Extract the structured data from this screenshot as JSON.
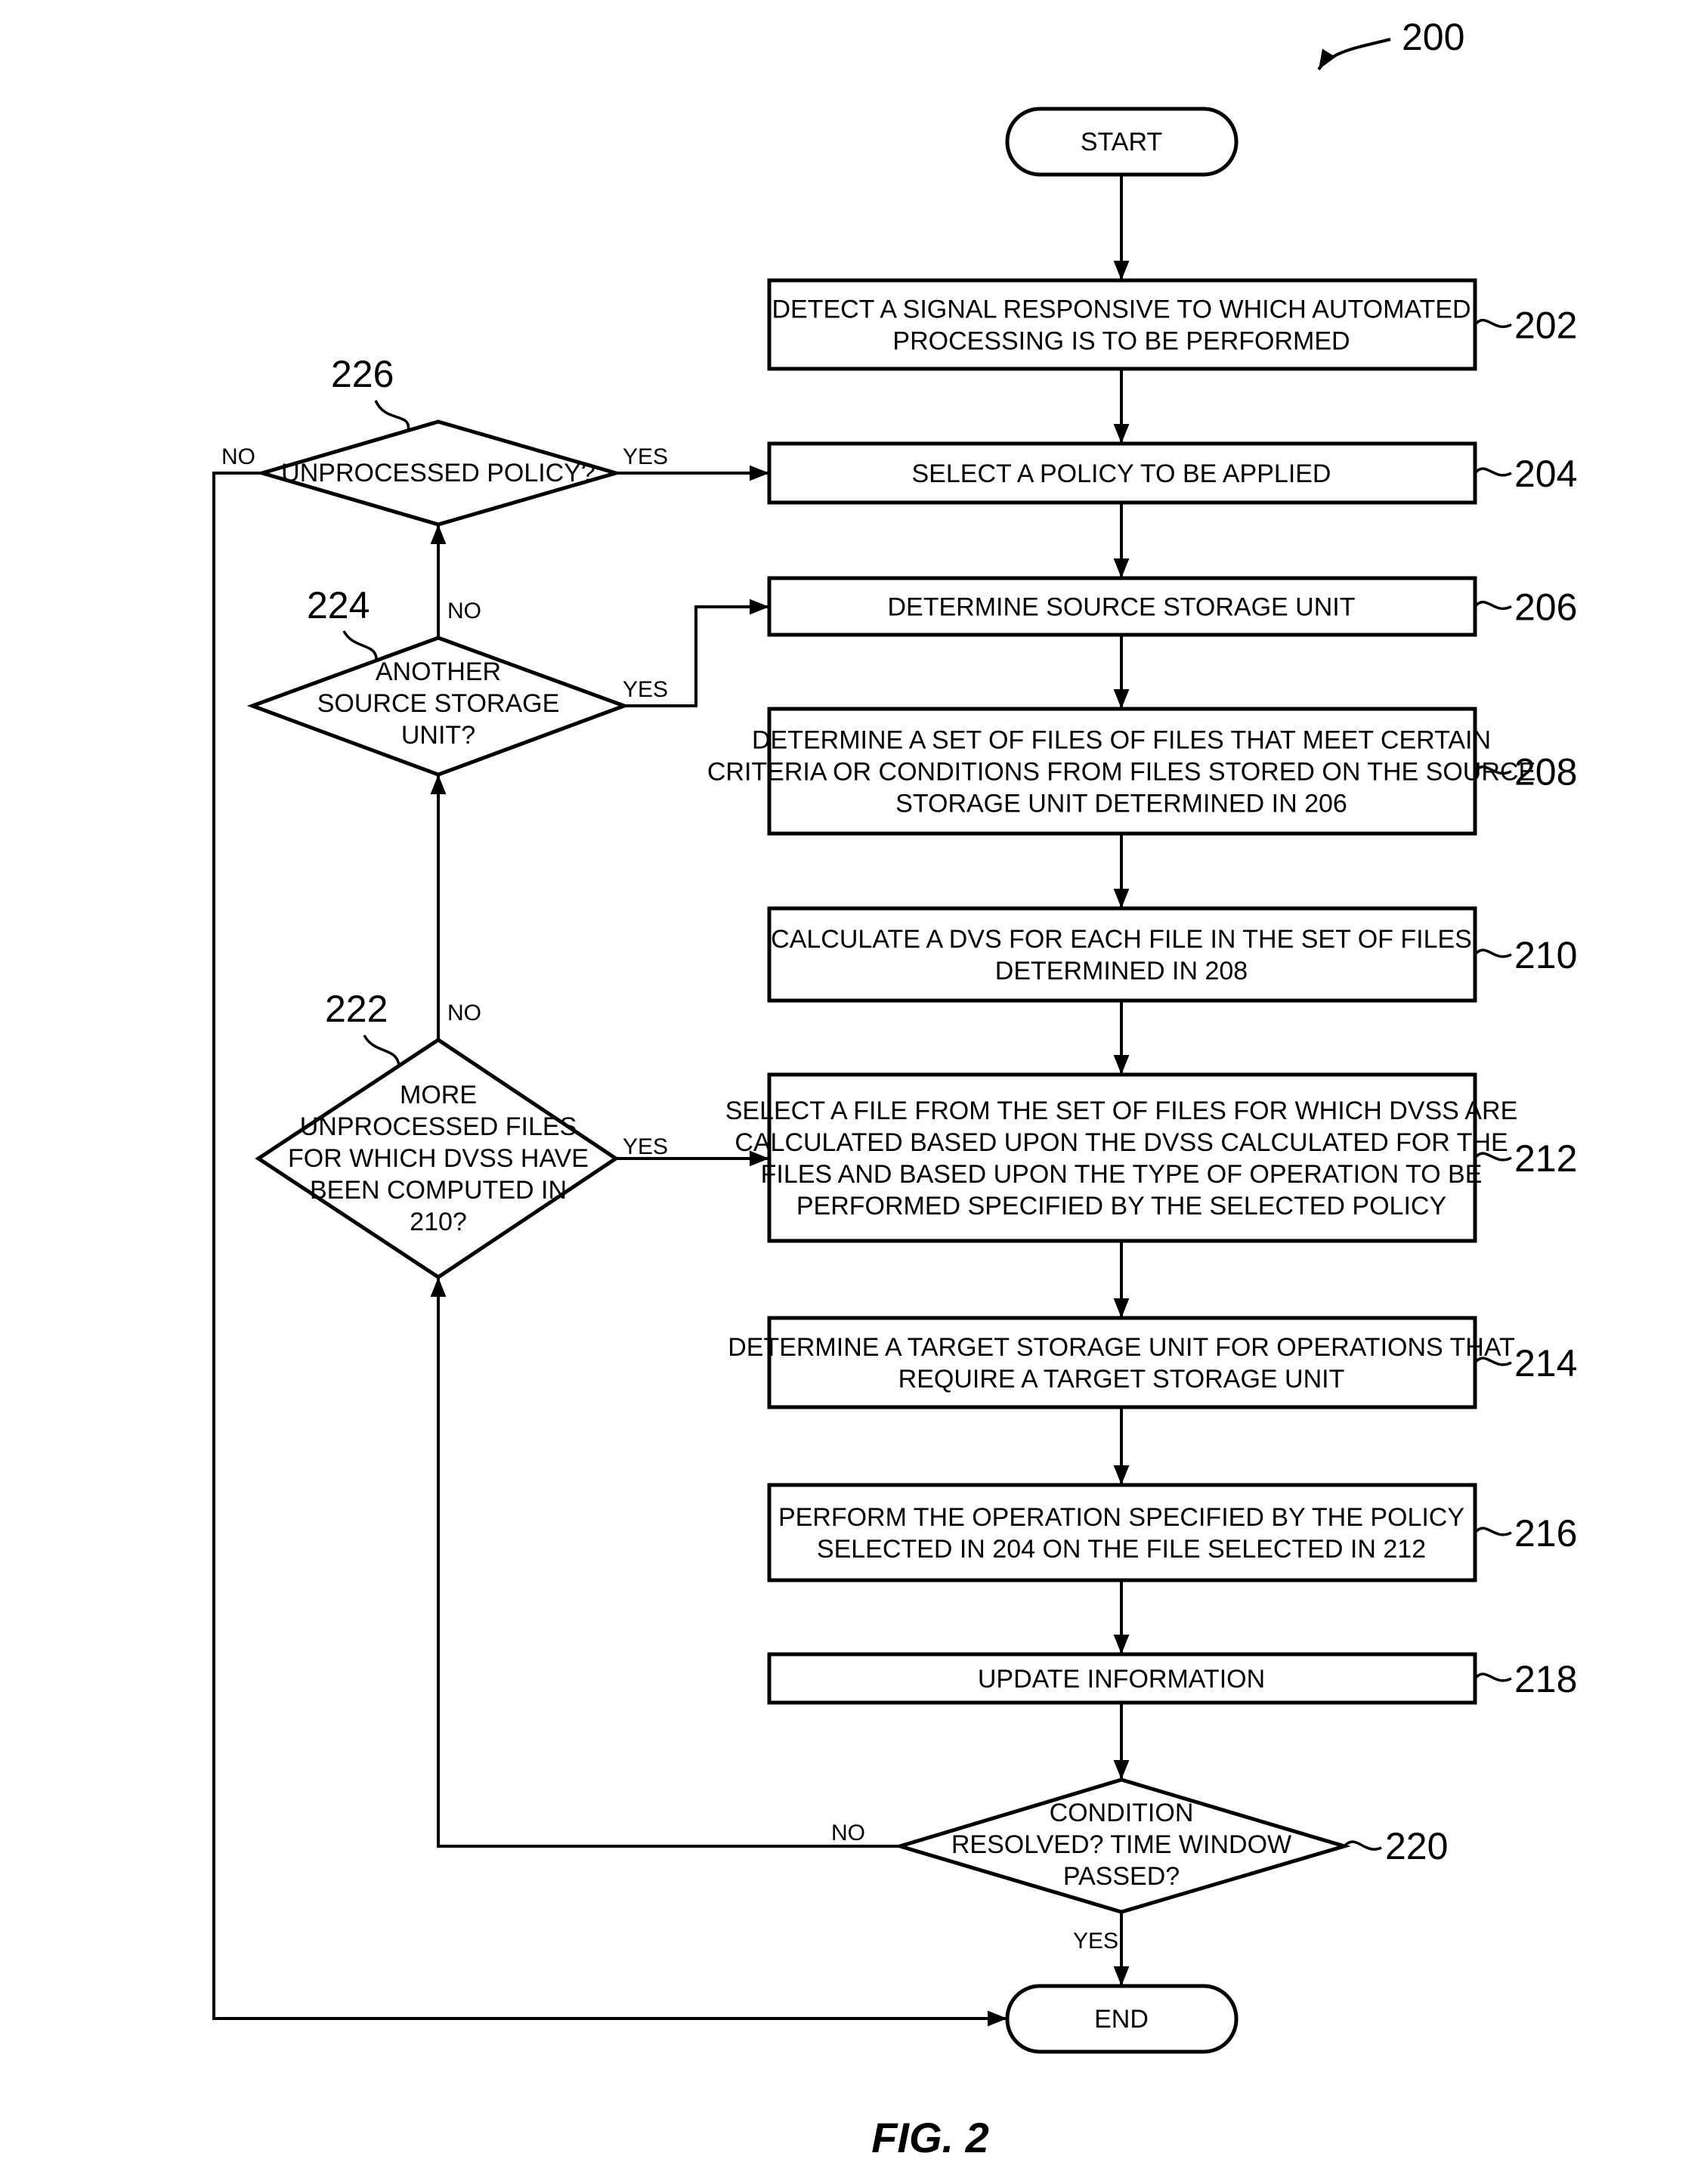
{
  "figure": {
    "number_label": "200",
    "caption": "FIG. 2"
  },
  "terminals": {
    "start": "START",
    "end": "END"
  },
  "steps": [
    {
      "ref": "202",
      "lines": [
        "DETECT A SIGNAL RESPONSIVE TO WHICH AUTOMATED",
        "PROCESSING IS TO BE PERFORMED"
      ]
    },
    {
      "ref": "204",
      "lines": [
        "SELECT A POLICY TO BE APPLIED"
      ]
    },
    {
      "ref": "206",
      "lines": [
        "DETERMINE SOURCE STORAGE UNIT"
      ]
    },
    {
      "ref": "208",
      "lines": [
        "DETERMINE A SET OF FILES OF FILES THAT MEET CERTAIN",
        "CRITERIA OR CONDITIONS FROM FILES STORED ON THE SOURCE",
        "STORAGE UNIT DETERMINED IN 206"
      ]
    },
    {
      "ref": "210",
      "lines": [
        "CALCULATE A DVS FOR EACH FILE IN THE SET OF FILES",
        "DETERMINED IN 208"
      ]
    },
    {
      "ref": "212",
      "lines": [
        "SELECT A FILE FROM THE SET OF FILES FOR WHICH DVSS ARE",
        "CALCULATED  BASED UPON THE DVSS CALCULATED FOR THE",
        "FILES AND BASED UPON THE TYPE OF OPERATION TO BE",
        "PERFORMED SPECIFIED BY THE SELECTED POLICY"
      ]
    },
    {
      "ref": "214",
      "lines": [
        "DETERMINE A TARGET STORAGE UNIT FOR OPERATIONS THAT",
        "REQUIRE A TARGET STORAGE UNIT"
      ]
    },
    {
      "ref": "216",
      "lines": [
        "PERFORM THE OPERATION SPECIFIED BY THE POLICY",
        "SELECTED IN 204 ON THE FILE SELECTED IN 212"
      ]
    },
    {
      "ref": "218",
      "lines": [
        "UPDATE INFORMATION"
      ]
    }
  ],
  "decisions": {
    "d220": {
      "ref": "220",
      "lines": [
        "CONDITION",
        "RESOLVED?  TIME WINDOW",
        "PASSED?"
      ],
      "yes": "YES",
      "no": "NO"
    },
    "d222": {
      "ref": "222",
      "lines": [
        "MORE",
        "UNPROCESSED FILES",
        "FOR WHICH DVSS HAVE",
        "BEEN COMPUTED IN",
        "210?"
      ],
      "yes": "YES",
      "no": "NO"
    },
    "d224": {
      "ref": "224",
      "lines": [
        "ANOTHER",
        "SOURCE STORAGE",
        "UNIT?"
      ],
      "yes": "YES",
      "no": "NO"
    },
    "d226": {
      "ref": "226",
      "lines": [
        "UNPROCESSED POLICY?"
      ],
      "yes": "YES",
      "no": "NO"
    }
  }
}
